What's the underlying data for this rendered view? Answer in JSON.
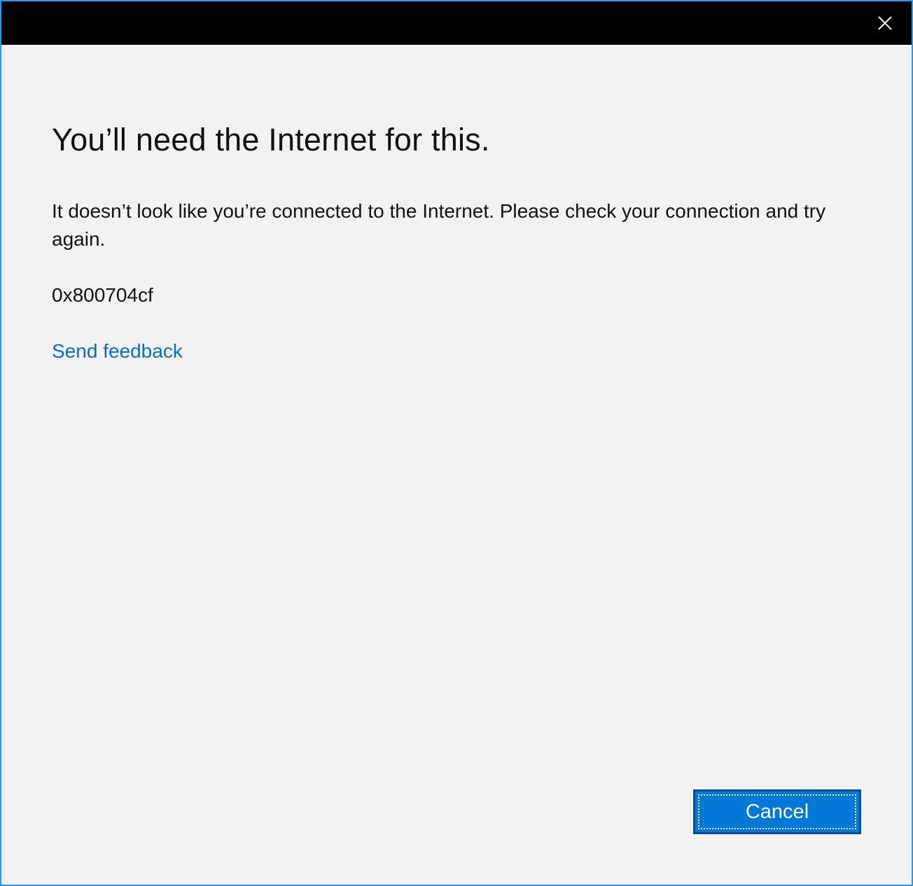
{
  "titlebar": {
    "close_icon": "close-icon"
  },
  "dialog": {
    "heading": "You’ll need the Internet for this.",
    "message": "It doesn’t look like you’re connected to the Internet. Please check your connection and try again.",
    "error_code": "0x800704cf",
    "feedback_link": "Send feedback",
    "cancel_label": "Cancel"
  },
  "colors": {
    "accent": "#0078d7",
    "link": "#0a6dc9",
    "titlebar": "#000000",
    "window_border": "#2b9ae8",
    "background": "#f2f2f2"
  }
}
